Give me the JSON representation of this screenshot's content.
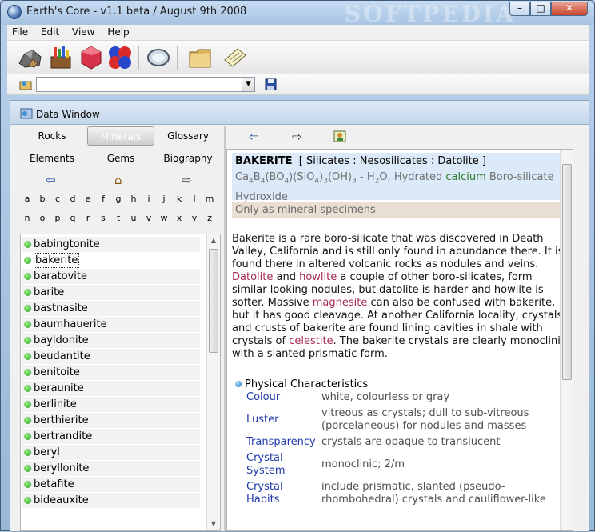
{
  "window": {
    "title": "Earth's Core - v1.1 beta / August 9th 2008",
    "watermark": "SOFTPEDIA"
  },
  "menu": [
    "File",
    "Edit",
    "View",
    "Help"
  ],
  "toolbar_icons": [
    "rocks-icon",
    "crayons-icon",
    "gem-icon",
    "molecule-icon",
    "magnifier-icon",
    "folder-icon",
    "notepad-icon"
  ],
  "address_bar": {
    "value": ""
  },
  "data_window": {
    "title": "Data Window"
  },
  "nav": {
    "buttons": [
      "Rocks",
      "Minerals",
      "Glossary",
      "Elements",
      "Gems",
      "Biography"
    ],
    "selected": "Minerals"
  },
  "letters": [
    "a",
    "b",
    "c",
    "d",
    "e",
    "f",
    "g",
    "h",
    "i",
    "j",
    "k",
    "l",
    "m",
    "n",
    "o",
    "p",
    "q",
    "r",
    "s",
    "t",
    "u",
    "v",
    "w",
    "x",
    "y",
    "z"
  ],
  "mineral_list": [
    "babingtonite",
    "bakerite",
    "baratovite",
    "barite",
    "bastnasite",
    "baumhauerite",
    "bayldonite",
    "beudantite",
    "benitoite",
    "beraunite",
    "berlinite",
    "berthierite",
    "bertrandite",
    "beryl",
    "beryllonite",
    "betafite",
    "bideauxite"
  ],
  "selected_mineral": "bakerite",
  "detail": {
    "name": "BAKERITE",
    "classification": "[  Silicates : Nesosilicates : Datolite  ]",
    "formula_extra_a": " - H",
    "formula_extra_b": "O, Hydrated ",
    "formula_green": "calcium",
    "formula_tail": " Boro-silicate Hydroxide",
    "note": "Only as mineral specimens",
    "desc_1": "Bakerite is a rare boro-silicate that was discovered in Death Valley, California and is still only found in abundance there. It is found there in altered volcanic rocks as nodules and veins. ",
    "link_1": "Datolite",
    "desc_2": " and ",
    "link_2": "howlite",
    "desc_3": " a couple of other boro-silicates, form similar looking nodules, but datolite is harder and howlite is softer. Massive ",
    "link_3": "magnesite",
    "desc_4": " can also be confused with bakerite, but it has good cleavage. At another California locality, crystals and crusts of bakerite are found lining cavities in shale with crystals of ",
    "link_4": "celestite",
    "desc_5": ". The bakerite crystals are clearly monoclinic with a slanted prismatic form.",
    "physical_heading": "Physical Characteristics",
    "properties": [
      {
        "label": "Colour",
        "value": "white, colourless or gray"
      },
      {
        "label": "Luster",
        "value": "vitreous as crystals; dull to sub-vitreous (porcelaneous) for nodules and masses"
      },
      {
        "label": "Transparency",
        "value": "crystals are opaque to translucent"
      },
      {
        "label": "Crystal System",
        "value": "monoclinic; 2/m"
      },
      {
        "label": "Crystal Habits",
        "value": "include prismatic, slanted (pseudo-rhombohedral) crystals and cauliflower-like"
      }
    ]
  }
}
